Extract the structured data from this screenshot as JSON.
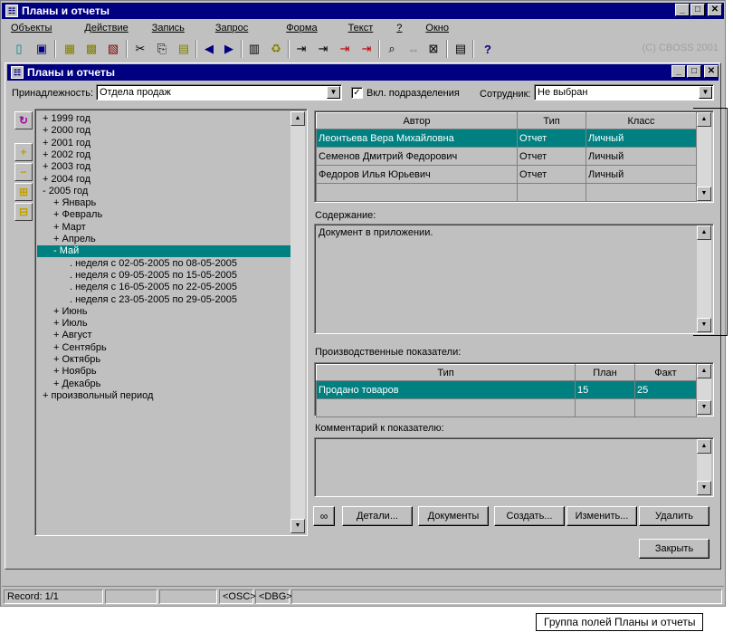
{
  "app": {
    "title": "Планы и отчеты",
    "copyright": "(C) CBOSS 2001"
  },
  "menu": [
    "Объекты",
    "Действие",
    "Запись",
    "Запрос",
    "Форма",
    "Текст",
    "?",
    "Окно"
  ],
  "child_window": {
    "title": "Планы и отчеты"
  },
  "filters": {
    "belongs_label": "Принадлежность:",
    "belongs_value": "Отдела продаж",
    "subdivisions_label": "Вкл. подразделения",
    "subdivisions_checked": "✓",
    "employee_label": "Сотрудник:",
    "employee_value": "Не выбран"
  },
  "tree": [
    {
      "label": "+ 1999 год",
      "indent": 0
    },
    {
      "label": "+ 2000 год",
      "indent": 0
    },
    {
      "label": "+ 2001 год",
      "indent": 0
    },
    {
      "label": "+ 2002 год",
      "indent": 0
    },
    {
      "label": "+ 2003 год",
      "indent": 0
    },
    {
      "label": "+ 2004 год",
      "indent": 0
    },
    {
      "label": "- 2005 год",
      "indent": 0
    },
    {
      "label": "+ Январь",
      "indent": 1
    },
    {
      "label": "+ Февраль",
      "indent": 1
    },
    {
      "label": "+ Март",
      "indent": 1
    },
    {
      "label": "+ Апрель",
      "indent": 1
    },
    {
      "label": "- Май",
      "indent": 1,
      "selected": true
    },
    {
      "label": ". неделя с 02-05-2005 по 08-05-2005",
      "indent": 2
    },
    {
      "label": ". неделя с 09-05-2005 по 15-05-2005",
      "indent": 2
    },
    {
      "label": ". неделя с 16-05-2005 по 22-05-2005",
      "indent": 2
    },
    {
      "label": ". неделя с 23-05-2005 по 29-05-2005",
      "indent": 2
    },
    {
      "label": "+ Июнь",
      "indent": 1
    },
    {
      "label": "+ Июль",
      "indent": 1
    },
    {
      "label": "+ Август",
      "indent": 1
    },
    {
      "label": "+ Сентябрь",
      "indent": 1
    },
    {
      "label": "+ Октябрь",
      "indent": 1
    },
    {
      "label": "+ Ноябрь",
      "indent": 1
    },
    {
      "label": "+ Декабрь",
      "indent": 1
    },
    {
      "label": "+ произвольный период",
      "indent": 0
    }
  ],
  "reports": {
    "columns": [
      "Автор",
      "Тип",
      "Класс"
    ],
    "rows": [
      [
        "Леонтьева Вера Михайловна",
        "Отчет",
        "Личный"
      ],
      [
        "Семенов Дмитрий Федорович",
        "Отчет",
        "Личный"
      ],
      [
        "Федоров Илья Юрьевич",
        "Отчет",
        "Личный"
      ],
      [
        "",
        "",
        ""
      ]
    ]
  },
  "content": {
    "label": "Содержание:",
    "text": "Документ в приложении."
  },
  "indicators": {
    "label": "Производственные показатели:",
    "columns": [
      "Тип",
      "План",
      "Факт"
    ],
    "rows": [
      [
        "Продано товаров",
        "15",
        "25"
      ],
      [
        "",
        "",
        ""
      ]
    ]
  },
  "comment": {
    "label": "Комментарий к показателю:",
    "text": ""
  },
  "buttons": {
    "details": "Детали...",
    "documents": "Документы",
    "create": "Создать...",
    "edit": "Изменить...",
    "delete": "Удалить",
    "close": "Закрыть"
  },
  "status": {
    "record": "Record: 1/1",
    "osc": "<OSC>",
    "dbg": "<DBG>"
  },
  "caption": "Группа полей Планы и отчеты",
  "colors": {
    "title": "#000080",
    "selection": "#008080",
    "face": "#c0c0c0"
  }
}
